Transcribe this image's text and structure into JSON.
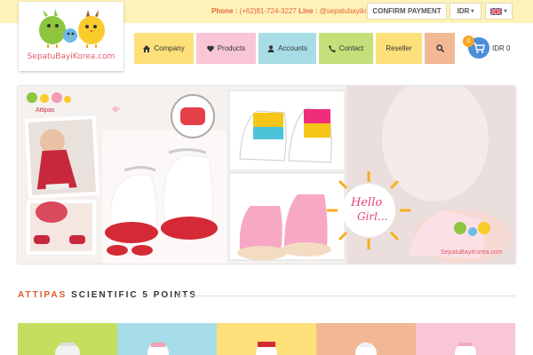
{
  "topbar": {
    "phone_label": "Phone :",
    "phone_value": "(+62)81-724-3227",
    "line_label": "Line :",
    "line_value": "@sepatubayikorea",
    "confirm_label": "CONFIRM PAYMENT",
    "currency": "IDR",
    "language_flag": "uk-flag-icon"
  },
  "logo": {
    "text": "SepatuBayiKorea.com"
  },
  "nav": {
    "company": "Company",
    "products": "Products",
    "accounts": "Accounts",
    "contact": "Contact",
    "reseller": "Reseller"
  },
  "cart": {
    "count": "0",
    "total": "IDR 0"
  },
  "hero": {
    "brand_label": "Attipas",
    "hello_text": "Hello",
    "girl_text": "Girl...",
    "watermark": "SepatuBayiKorea.com"
  },
  "section": {
    "title_a": "ATTIPAS",
    "title_b": "SCIENTIFIC 5 POINTS"
  },
  "colors": {
    "topbar_bg": "#fdf2b8",
    "accent_orange": "#e8673a",
    "nav_company": "#fde07a",
    "nav_products": "#f9c6d6",
    "nav_accounts": "#a9dde6",
    "nav_contact": "#c5e07a",
    "nav_reseller": "#fde07a",
    "nav_search": "#f2b895",
    "cart_blue": "#4a8fd8",
    "tiles": [
      "#c4df5f",
      "#a6dde8",
      "#fde07a",
      "#f2b895",
      "#f9c6d6"
    ]
  }
}
